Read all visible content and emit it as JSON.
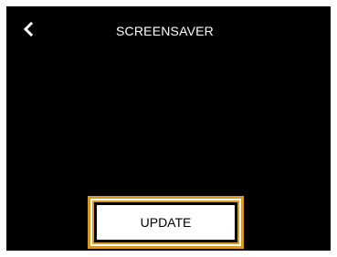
{
  "header": {
    "title": "SCREENSAVER",
    "back_icon": "chevron-left-icon"
  },
  "actions": {
    "update_label": "UPDATE"
  },
  "colors": {
    "background": "#000000",
    "text": "#ffffff",
    "focus_ring": "#d89a23",
    "button_background": "#ffffff",
    "button_text": "#000000"
  }
}
